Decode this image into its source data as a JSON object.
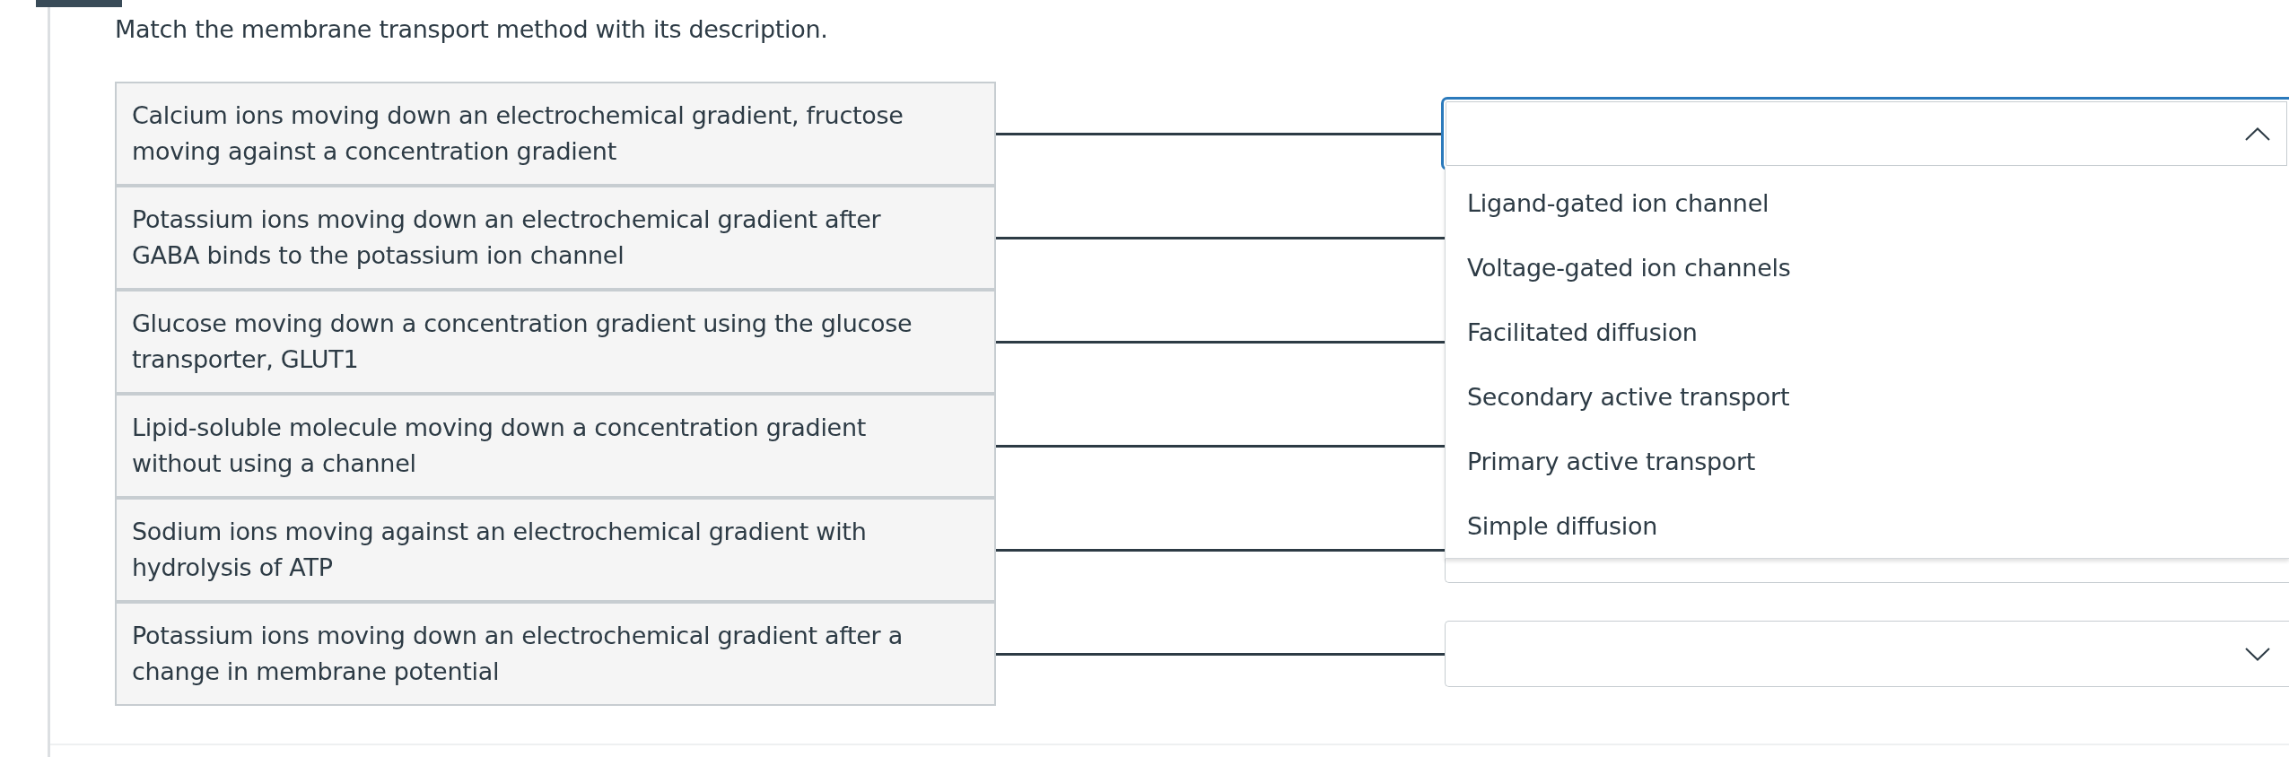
{
  "question": "Match the membrane transport method with its description.",
  "pairs": [
    {
      "description": "Calcium ions moving down an electrochemical gradient, fructose moving against a concentration gradient",
      "answer": {
        "expanded": true,
        "options": [
          {
            "label": "Ligand-gated ion channel",
            "selected": false
          },
          {
            "label": "Voltage-gated ion channels",
            "selected": false
          },
          {
            "label": "Facilitated diffusion",
            "selected": false
          },
          {
            "label": "Secondary active transport",
            "selected": false
          },
          {
            "label": "Primary active transport",
            "selected": false
          },
          {
            "label": "Simple diffusion",
            "selected": false
          }
        ]
      }
    },
    {
      "description": "Potassium ions moving down an electrochemical gradient after GABA binds to the potassium ion channel"
    },
    {
      "description": "Glucose moving down a concentration gradient using the glucose transporter, GLUT1"
    },
    {
      "description": "Lipid-soluble molecule moving down a concentration gradient without using a channel"
    },
    {
      "description": "Sodium ions moving against an electrochemical gradient with hydrolysis of ATP",
      "answer": {
        "expanded": false
      }
    },
    {
      "description": "Potassium ions moving down an electrochemical gradient after a change in membrane potential",
      "answer": {
        "expanded": false
      }
    }
  ]
}
